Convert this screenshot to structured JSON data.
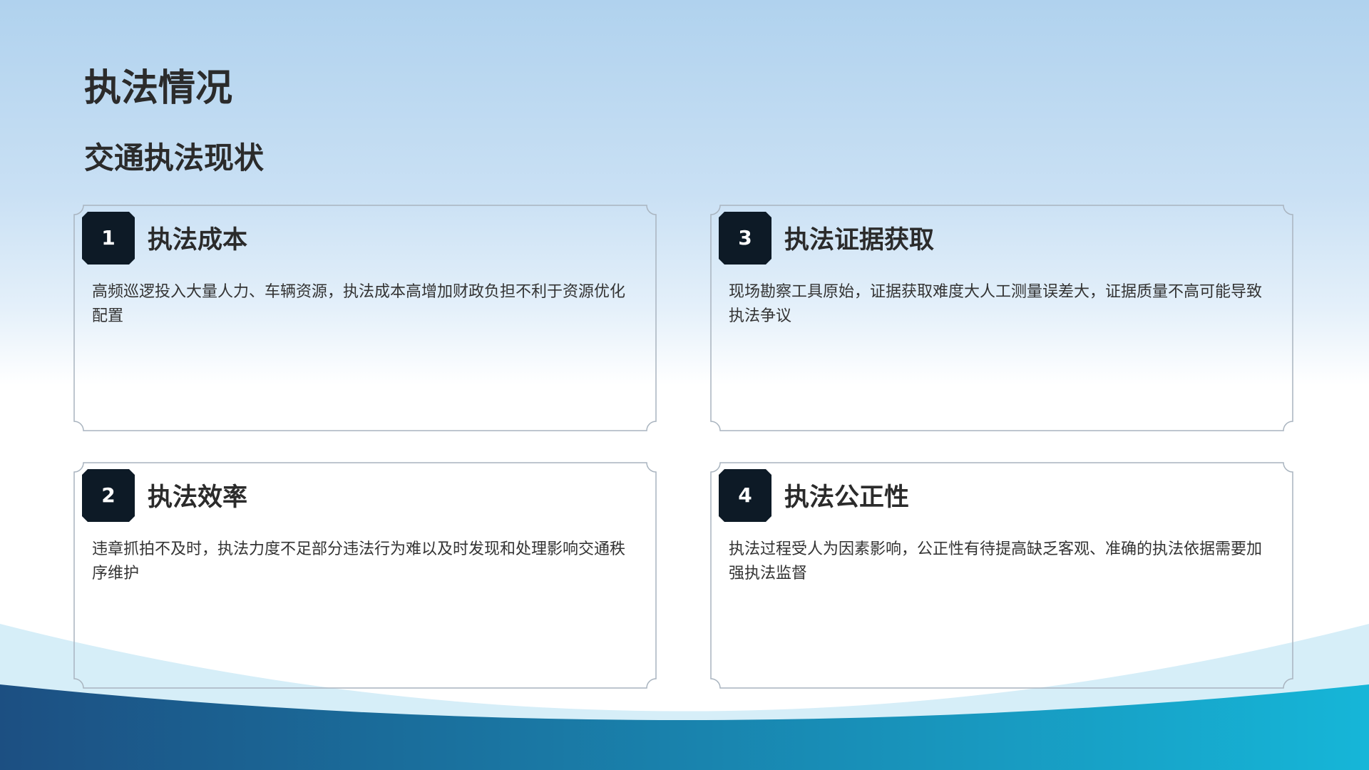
{
  "slide": {
    "title": "执法情况",
    "subtitle": "交通执法现状",
    "cards": [
      {
        "number": "1",
        "title": "执法成本",
        "text": "高频巡逻投入大量人力、车辆资源，执法成本高增加财政负担不利于资源优化配置"
      },
      {
        "number": "3",
        "title": "执法证据获取",
        "text": "现场勘察工具原始，证据获取难度大人工测量误差大，证据质量不高可能导致执法争议"
      },
      {
        "number": "2",
        "title": "执法效率",
        "text": "违章抓拍不及时，执法力度不足部分违法行为难以及时发现和处理影响交通秩序维护"
      },
      {
        "number": "4",
        "title": "执法公正性",
        "text": "执法过程受人为因素影响，公正性有待提高缺乏客观、准确的执法依据需要加强执法监督"
      }
    ]
  },
  "colors": {
    "badge": "#0d1a26",
    "card_border": "#a9b4bf",
    "wave_light": "#d6eef8",
    "wave_dark_start": "#1c4f82",
    "wave_dark_end": "#16b6d8",
    "heading_text": "#2b2b2b",
    "body_text": "#333333"
  }
}
